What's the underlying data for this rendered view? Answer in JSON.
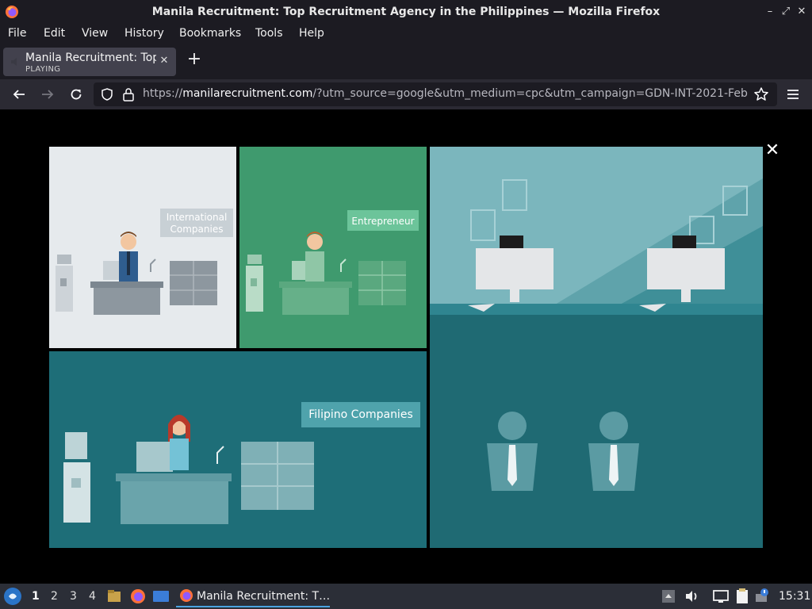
{
  "window": {
    "title": "Manila Recruitment: Top Recruitment Agency in the Philippines — Mozilla Firefox"
  },
  "menu": [
    "File",
    "Edit",
    "View",
    "History",
    "Bookmarks",
    "Tools",
    "Help"
  ],
  "tab": {
    "title": "Manila Recruitment: Top Recruitment Agency in the Philippines",
    "status": "PLAYING"
  },
  "urlbar": {
    "prefix": "https://",
    "host": "manilarecruitment.com",
    "path": "/?utm_source=google&utm_medium=cpc&utm_campaign=GDN-INT-2021-Feb"
  },
  "illustration": {
    "labels": {
      "international_line1": "International",
      "international_line2": "Companies",
      "entrepreneur": "Entrepreneur",
      "filipino": "Filipino Companies"
    }
  },
  "taskbar": {
    "workspaces": [
      "1",
      "2",
      "3",
      "4"
    ],
    "active_workspace": "1",
    "task_label": "Manila Recruitment: T…",
    "clock": "15:31"
  },
  "colors": {
    "firefox_bg": "#1c1b22",
    "navbar_bg": "#2b2a33",
    "panel_light": "#e6eaed",
    "panel_green": "#3f9a6e",
    "panel_teal": "#1e6e78",
    "panel_sky": "#7bb6bd"
  }
}
